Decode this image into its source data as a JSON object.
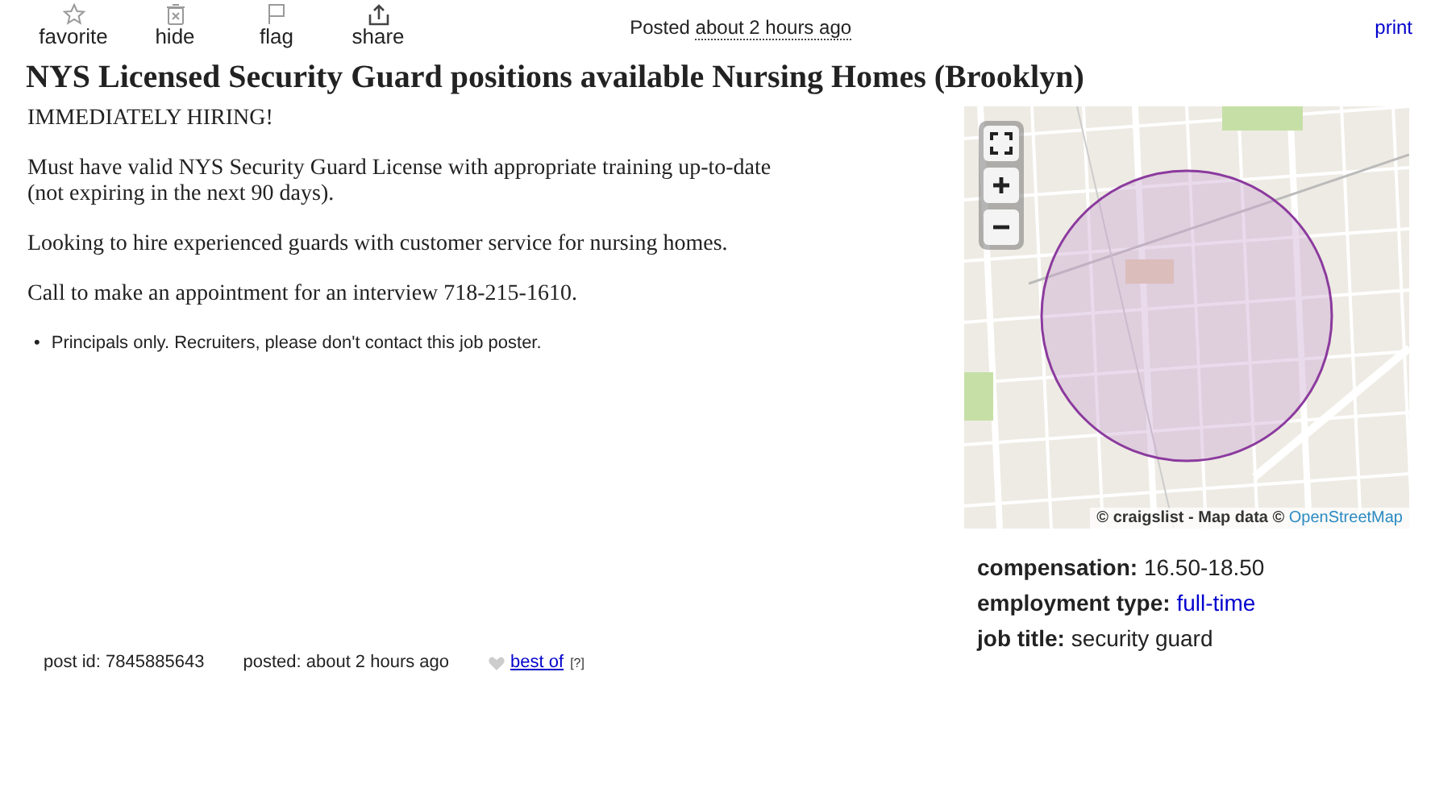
{
  "actions": [
    {
      "kind": "star",
      "label": "favorite"
    },
    {
      "kind": "trash",
      "label": "hide"
    },
    {
      "kind": "flag",
      "label": "flag"
    },
    {
      "kind": "share",
      "label": "share"
    }
  ],
  "posted": {
    "label": "Posted",
    "time": "about 2 hours ago"
  },
  "print": "print",
  "title": "NYS Licensed Security Guard positions available Nursing Homes (Brooklyn)",
  "body": [
    "IMMEDIATELY HIRING!",
    "Must have valid NYS Security Guard License with appropriate training up-to-date (not expiring in the next 90 days).",
    "Looking to hire experienced guards with customer service for nursing homes.",
    "Call to make an appointment for an interview 718-215-1610."
  ],
  "notices": [
    {
      "bullet": "•",
      "text": "Principals only. Recruiters, please don't contact this job poster."
    }
  ],
  "map": {
    "controls": [
      {
        "kind": "fullscreen"
      },
      {
        "kind": "zoom-in"
      },
      {
        "kind": "zoom-out"
      }
    ],
    "attribution": "© craigslist - Map data ©",
    "attribution_link": "OpenStreetMap"
  },
  "attributes": [
    {
      "label": "compensation:",
      "value": "16.50-18.50",
      "link": false
    },
    {
      "label": "employment type:",
      "value": "full-time",
      "link": true
    },
    {
      "label": "job title:",
      "value": "security guard",
      "link": false
    }
  ],
  "footer": {
    "post_id": "post id: 7845885643",
    "posted_label": "posted:",
    "posted_time": "about 2 hours ago",
    "best_of": "best of",
    "help": "[?]"
  }
}
